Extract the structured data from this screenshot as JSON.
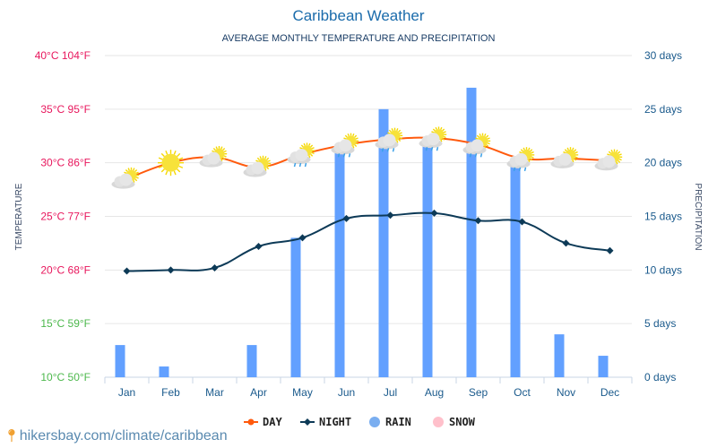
{
  "chart_data": {
    "type": "bar+line",
    "title": "Caribbean Weather",
    "subtitle": "AVERAGE MONTHLY TEMPERATURE AND PRECIPITATION",
    "categories": [
      "Jan",
      "Feb",
      "Mar",
      "Apr",
      "May",
      "Jun",
      "Jul",
      "Aug",
      "Sep",
      "Oct",
      "Nov",
      "Dec"
    ],
    "series": [
      {
        "name": "DAY",
        "type": "line",
        "axis": "left",
        "unit": "°C",
        "color": "#ff5a0d",
        "values": [
          28.5,
          30.0,
          30.5,
          29.6,
          30.8,
          31.7,
          32.2,
          32.3,
          31.7,
          30.4,
          30.4,
          30.2
        ],
        "weather_icons": [
          "partly-cloudy",
          "sunny",
          "partly-cloudy",
          "partly-cloudy",
          "cloudy-rain",
          "cloudy-rain",
          "cloudy-rain",
          "cloudy-rain",
          "cloudy-rain",
          "cloudy-rain",
          "partly-cloudy",
          "partly-cloudy"
        ]
      },
      {
        "name": "NIGHT",
        "type": "line",
        "axis": "left",
        "unit": "°C",
        "color": "#0d3a57",
        "values": [
          19.9,
          20.0,
          20.2,
          22.2,
          23.0,
          24.8,
          25.1,
          25.3,
          24.6,
          24.5,
          22.5,
          21.8
        ]
      },
      {
        "name": "RAIN",
        "type": "bar",
        "axis": "right",
        "unit": "days",
        "color": "#62a0ff",
        "values": [
          3,
          1,
          0,
          3,
          13,
          21,
          25,
          22,
          27,
          20,
          4,
          2
        ]
      },
      {
        "name": "SNOW",
        "type": "bar",
        "axis": "right",
        "unit": "days",
        "color": "#ffc0cb",
        "values": [
          0,
          0,
          0,
          0,
          0,
          0,
          0,
          0,
          0,
          0,
          0,
          0
        ]
      }
    ],
    "ylabel": "TEMPERATURE",
    "ylabel_right": "PRECIPITATION",
    "ylim": [
      10,
      40
    ],
    "ylim_right": [
      0,
      30
    ],
    "yticks": [
      {
        "label": "40°C 104°F",
        "value": 40,
        "color": "#e8175d"
      },
      {
        "label": "35°C 95°F",
        "value": 35,
        "color": "#e8175d"
      },
      {
        "label": "30°C 86°F",
        "value": 30,
        "color": "#e8175d"
      },
      {
        "label": "25°C 77°F",
        "value": 25,
        "color": "#e8175d"
      },
      {
        "label": "20°C 68°F",
        "value": 20,
        "color": "#e8175d"
      },
      {
        "label": "15°C 59°F",
        "value": 15,
        "color": "#4cb84c"
      },
      {
        "label": "10°C 50°F",
        "value": 10,
        "color": "#4cb84c"
      }
    ],
    "yticks_right": [
      {
        "label": "30 days",
        "value": 30
      },
      {
        "label": "25 days",
        "value": 25
      },
      {
        "label": "20 days",
        "value": 20
      },
      {
        "label": "15 days",
        "value": 15
      },
      {
        "label": "10 days",
        "value": 10
      },
      {
        "label": "5 days",
        "value": 5
      },
      {
        "label": "0 days",
        "value": 0
      }
    ],
    "grid": true,
    "legend": {
      "position": "bottom-center",
      "items": [
        "DAY",
        "NIGHT",
        "RAIN",
        "SNOW"
      ]
    }
  },
  "source": {
    "text": "hikersbay.com/climate/caribbean",
    "icon": "location-pin-icon"
  }
}
